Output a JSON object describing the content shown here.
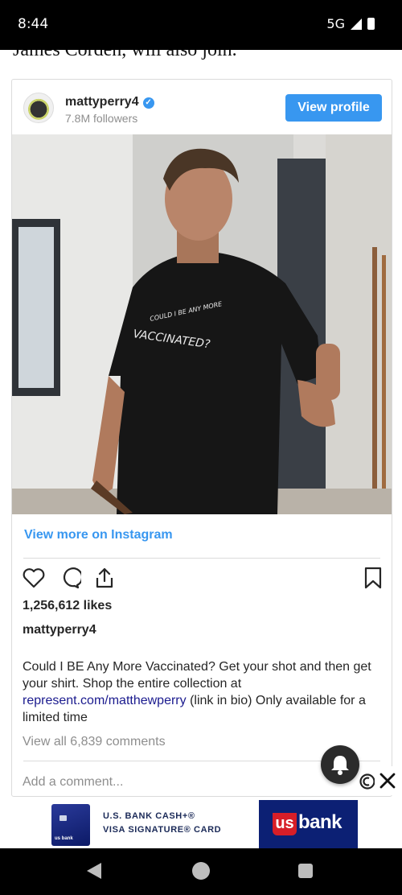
{
  "status_bar": {
    "time": "8:44",
    "network": "5G"
  },
  "article": {
    "partial_text": "James Corden, will also join."
  },
  "embed": {
    "username": "mattyperry4",
    "followers": "7.8M followers",
    "view_profile_label": "View profile",
    "photo_shirt_text_1": "COULD I BE ANY MORE",
    "photo_shirt_text_2": "VACCINATED?",
    "view_more_label": "View more on Instagram",
    "likes": "1,256,612 likes",
    "post_username": "mattyperry4",
    "caption_before_link": "Could I BE Any More Vaccinated? Get your shot and then get your shirt. Shop the entire collection at ",
    "caption_link": "represent.com/matthewperry",
    "caption_after_link": " (link in bio) Only available for a limited time",
    "view_comments": "View all 6,839 comments",
    "add_comment_placeholder": "Add a comment...",
    "accent_color": "#3897f0"
  },
  "ad": {
    "line1": "U.S. BANK CASH+®",
    "line2": "VISA SIGNATURE® CARD",
    "card_label": "us bank",
    "logo_us": "us",
    "logo_bank": "bank"
  },
  "icons": [
    "heart-icon",
    "comment-icon",
    "share-icon",
    "bookmark-icon",
    "bell-icon",
    "ad-choices-icon",
    "close-icon"
  ]
}
